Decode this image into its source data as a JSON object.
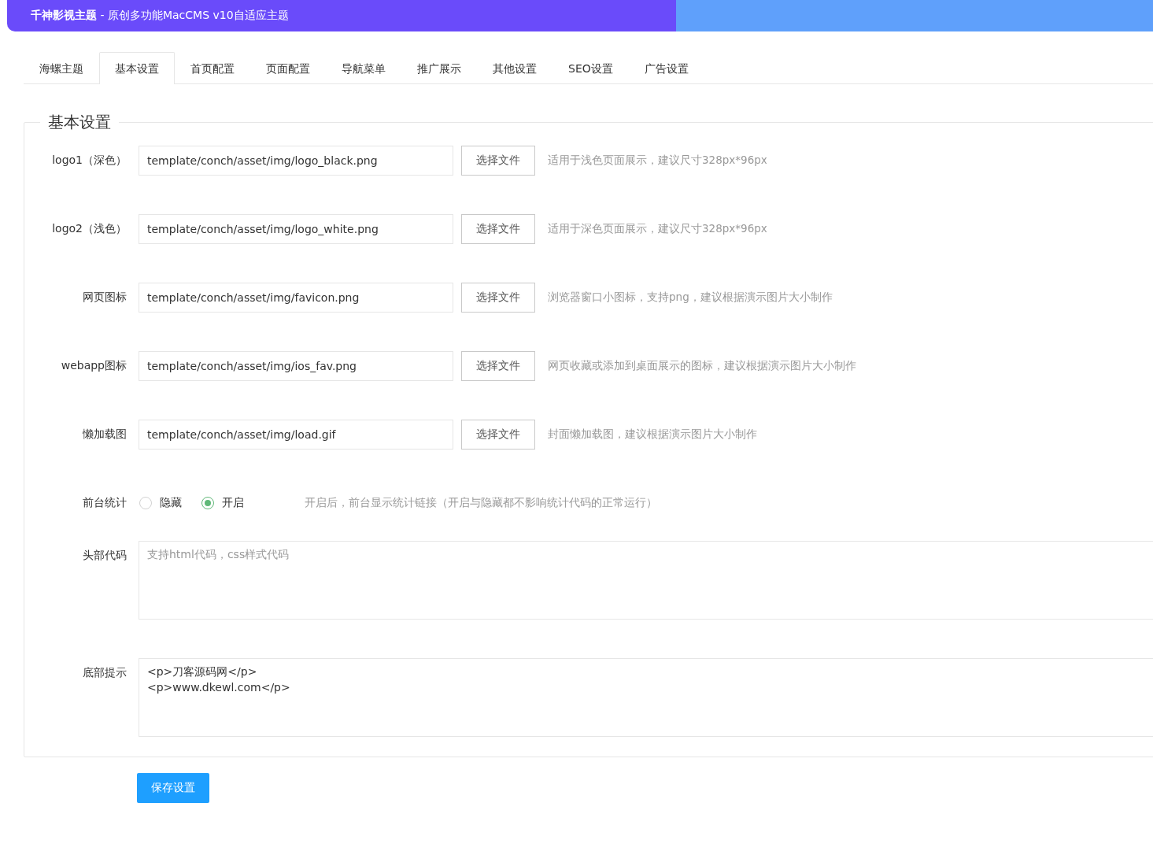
{
  "header": {
    "title": "千神影视主题",
    "subtitle": " - 原创多功能MacCMS v10自适应主题"
  },
  "tabs": [
    {
      "label": "海螺主题",
      "selected": false
    },
    {
      "label": "基本设置",
      "selected": true
    },
    {
      "label": "首页配置",
      "selected": false
    },
    {
      "label": "页面配置",
      "selected": false
    },
    {
      "label": "导航菜单",
      "selected": false
    },
    {
      "label": "推广展示",
      "selected": false
    },
    {
      "label": "其他设置",
      "selected": false
    },
    {
      "label": "SEO设置",
      "selected": false
    },
    {
      "label": "广告设置",
      "selected": false
    }
  ],
  "section": {
    "legend": "基本设置",
    "fields": [
      {
        "kind": "file",
        "label": "logo1（深色）",
        "value": "template/conch/asset/img/logo_black.png",
        "button": "选择文件",
        "hint": "适用于浅色页面展示，建议尺寸328px*96px"
      },
      {
        "kind": "file",
        "label": "logo2（浅色）",
        "value": "template/conch/asset/img/logo_white.png",
        "button": "选择文件",
        "hint": "适用于深色页面展示，建议尺寸328px*96px"
      },
      {
        "kind": "file",
        "label": "网页图标",
        "value": "template/conch/asset/img/favicon.png",
        "button": "选择文件",
        "hint": "浏览器窗口小图标，支持png，建议根据演示图片大小制作"
      },
      {
        "kind": "file",
        "label": "webapp图标",
        "value": "template/conch/asset/img/ios_fav.png",
        "button": "选择文件",
        "hint": "网页收藏或添加到桌面展示的图标，建议根据演示图片大小制作"
      },
      {
        "kind": "file",
        "label": "懒加载图",
        "value": "template/conch/asset/img/load.gif",
        "button": "选择文件",
        "hint": "封面懒加载图，建议根据演示图片大小制作"
      },
      {
        "kind": "radio",
        "label": "前台统计",
        "options": [
          {
            "label": "隐藏",
            "selected": false
          },
          {
            "label": "开启",
            "selected": true
          }
        ],
        "hint": "开启后，前台显示统计链接（开启与隐藏都不影响统计代码的正常运行）"
      },
      {
        "kind": "textarea",
        "label": "头部代码",
        "placeholder": "支持html代码，css样式代码"
      },
      {
        "kind": "textarea",
        "label": "底部提示",
        "value": "<p>刀客源码网</p>\n<p>www.dkewl.com</p>"
      }
    ]
  },
  "save_button": "保存设置"
}
